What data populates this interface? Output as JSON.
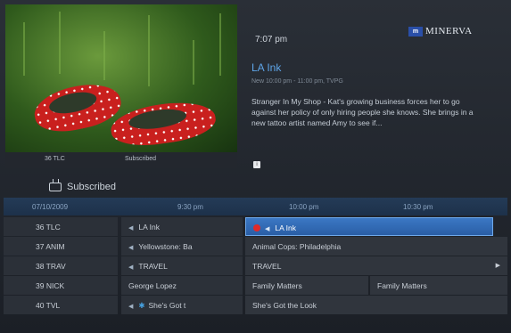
{
  "preview": {
    "channel": "36 TLC",
    "caption": "Subscribed"
  },
  "info": {
    "time": "7:07 pm",
    "logo_mark": "m",
    "logo_name": "MINERVA",
    "title": "LA Ink",
    "meta": "New 10:00 pm - 11:00 pm, TVPG",
    "description": "Stranger In My Shop - Kat's growing business forces her to go against her policy of only hiring people she knows. She brings in a new tattoo artist named Amy to see if...",
    "info_icon": "i"
  },
  "guide": {
    "header": "Subscribed",
    "date": "07/10/2009",
    "times": [
      "9:30 pm",
      "10:00 pm",
      "10:30 pm"
    ],
    "rows": [
      {
        "channel": "36 TLC",
        "cells": [
          {
            "text": "LA Ink",
            "arrow": true
          },
          {
            "text": "LA Ink",
            "selected": true,
            "rec": true,
            "arrow": true
          }
        ]
      },
      {
        "channel": "37 ANIM",
        "cells": [
          {
            "text": "Yellowstone: Ba",
            "arrow": true
          },
          {
            "text": "Animal Cops: Philadelphia"
          }
        ]
      },
      {
        "channel": "38 TRAV",
        "cells": [
          {
            "text": "TRAVEL",
            "arrow": true
          },
          {
            "text": "TRAVEL",
            "more": true
          }
        ]
      },
      {
        "channel": "39 NICK",
        "cells": [
          {
            "text": "George Lopez"
          },
          {
            "text": "Family Matters"
          },
          {
            "text": "Family Matters"
          }
        ]
      },
      {
        "channel": "40 TVL",
        "cells": [
          {
            "text": "She's Got t",
            "arrow": true,
            "star": true
          },
          {
            "text": "She's Got the Look"
          }
        ]
      }
    ]
  },
  "colors": {
    "accent": "#5ea5e8",
    "selected_cell": "#3b78c4",
    "record": "#e02a2a"
  }
}
